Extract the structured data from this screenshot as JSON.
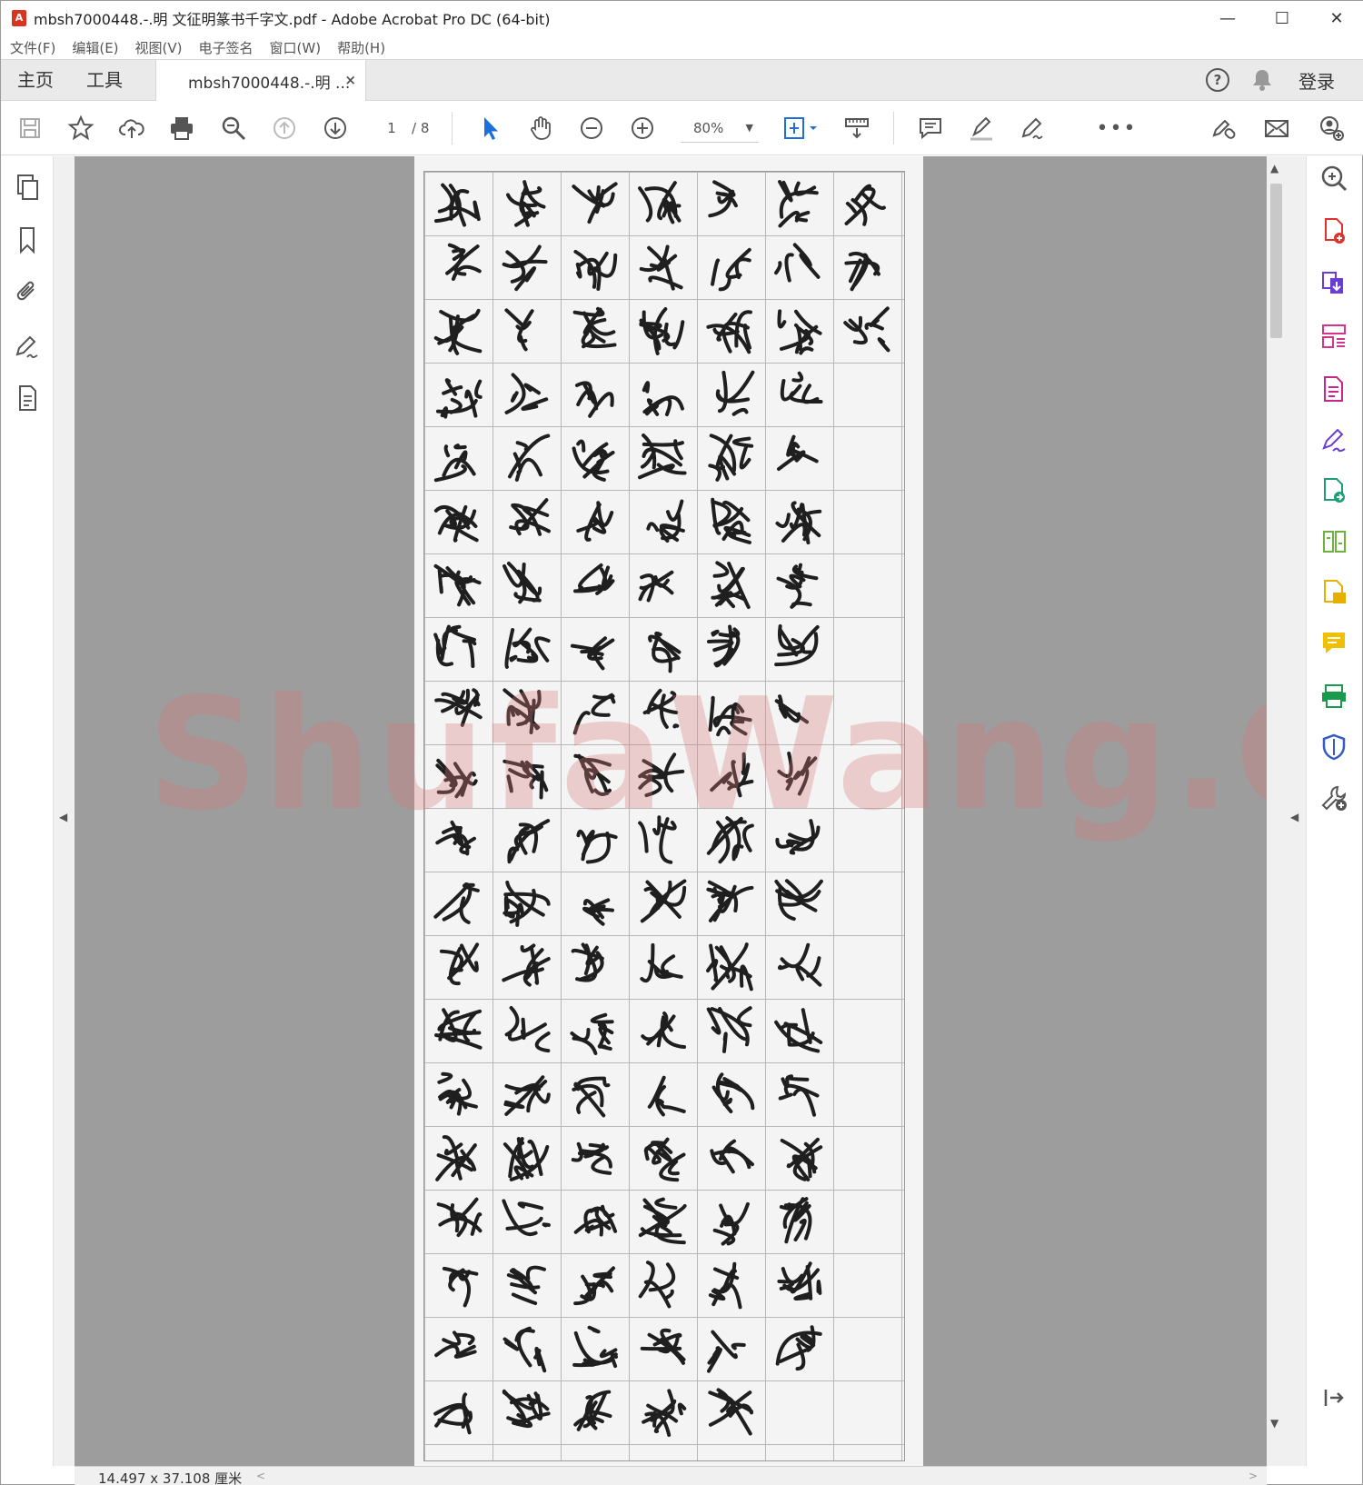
{
  "window": {
    "title": "mbsh7000448.-.明 文征明篆书千字文.pdf - Adobe Acrobat Pro DC (64-bit)",
    "minimize": "—",
    "maximize": "☐",
    "close": "✕"
  },
  "menu": [
    "文件(F)",
    "编辑(E)",
    "视图(V)",
    "电子签名",
    "窗口(W)",
    "帮助(H)"
  ],
  "tabs": {
    "home": "主页",
    "tools": "工具",
    "document": "mbsh7000448.-.明 ...",
    "close": "×",
    "login": "登录"
  },
  "toolbar": {
    "page_current": "1",
    "page_total": "/ 8",
    "zoom": "80%",
    "zoom_caret": "▼",
    "more": "•••"
  },
  "status": {
    "page_size": "14.497 x 37.108 厘米"
  },
  "watermark": "ShufaWang.CN",
  "colors": {
    "acrobat_red": "#d9341f",
    "select_blue": "#1e6fd9",
    "doc_background": "#9d9d9d"
  }
}
